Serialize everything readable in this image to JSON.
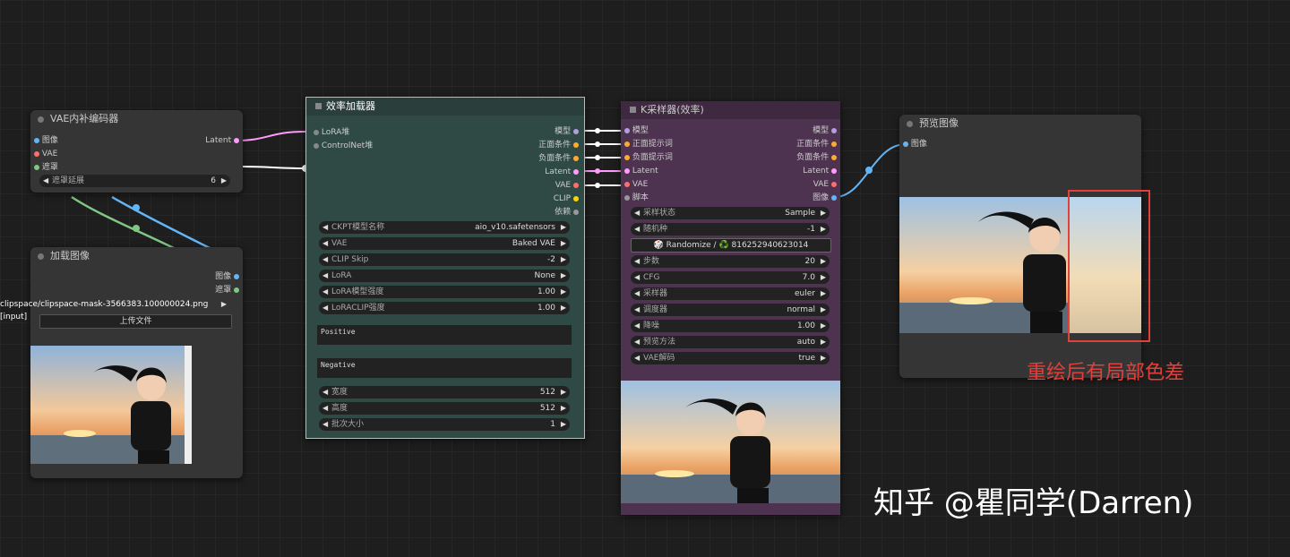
{
  "colors": {
    "latent": "#ff9cf9",
    "image": "#64b5f6",
    "vae": "#ff6e6e",
    "mask": "#81c784",
    "model": "#b39ddb",
    "cond": "#ffa931",
    "annot": "#e0413a"
  },
  "vae_encode": {
    "title": "VAE内补编码器",
    "in_image": "图像",
    "in_vae": "VAE",
    "in_mask": "遮罩",
    "out_latent": "Latent",
    "grow_label": "遮罩延展",
    "grow_value": "6"
  },
  "load_image": {
    "title": "加载图像",
    "out_image": "图像",
    "out_mask": "遮罩",
    "file": "clipspace/clipspace-mask-3566383.100000024.png [input]",
    "upload": "上传文件"
  },
  "loader": {
    "title": "效率加载器",
    "in_lora": "LoRA堆",
    "in_controlnet": "ControlNet堆",
    "outs": [
      "模型",
      "正面条件",
      "负面条件",
      "Latent",
      "VAE",
      "CLIP",
      "依赖"
    ],
    "widgets": [
      {
        "label": "CKPT模型名称",
        "value": "aio_v10.safetensors"
      },
      {
        "label": "VAE",
        "value": "Baked VAE"
      },
      {
        "label": "CLIP Skip",
        "value": "-2"
      },
      {
        "label": "LoRA",
        "value": "None"
      },
      {
        "label": "LoRA模型强度",
        "value": "1.00"
      },
      {
        "label": "LoRACLIP强度",
        "value": "1.00"
      }
    ],
    "positive": "Positive",
    "negative": "Negative",
    "widgets2": [
      {
        "label": "宽度",
        "value": "512"
      },
      {
        "label": "高度",
        "value": "512"
      },
      {
        "label": "批次大小",
        "value": "1"
      }
    ]
  },
  "ksampler": {
    "title": "K采样器(效率)",
    "ins": [
      "模型",
      "正面提示词",
      "负面提示词",
      "Latent",
      "VAE",
      "脚本"
    ],
    "outs": [
      "模型",
      "正面条件",
      "负面条件",
      "Latent",
      "VAE",
      "图像"
    ],
    "widgets_a": [
      {
        "label": "采样状态",
        "value": "Sample"
      },
      {
        "label": "随机种",
        "value": "-1"
      }
    ],
    "randomize": "🎲 Randomize / ♻️ 816252940623014",
    "widgets_b": [
      {
        "label": "步数",
        "value": "20"
      },
      {
        "label": "CFG",
        "value": "7.0"
      },
      {
        "label": "采样器",
        "value": "euler"
      },
      {
        "label": "调度器",
        "value": "normal"
      },
      {
        "label": "降噪",
        "value": "1.00"
      },
      {
        "label": "预览方法",
        "value": "auto"
      },
      {
        "label": "VAE解码",
        "value": "true"
      }
    ]
  },
  "preview": {
    "title": "预览图像",
    "in_image": "图像"
  },
  "annotation": "重绘后有局部色差",
  "watermark": "知乎 @瞿同学(Darren)"
}
